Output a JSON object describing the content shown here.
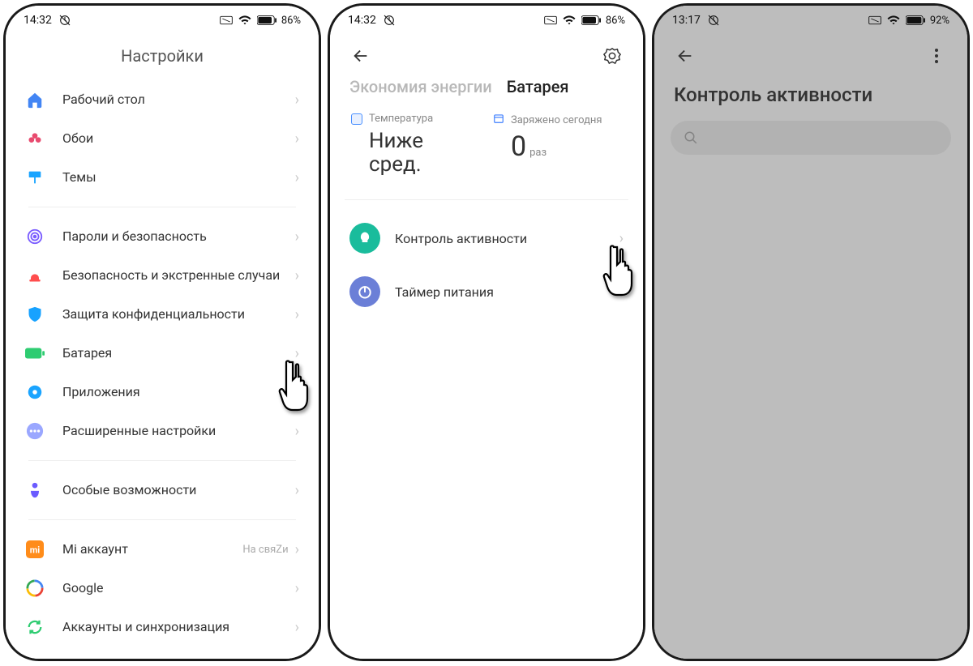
{
  "phones": [
    {
      "status": {
        "time": "14:32",
        "battery_pct": "86%"
      },
      "title": "Настройки",
      "groups": [
        [
          {
            "key": "desktop",
            "label": "Рабочий стол",
            "icon": "home",
            "color": "#4285f4"
          },
          {
            "key": "wallpaper",
            "label": "Обои",
            "icon": "flower",
            "color": "#e84b6f"
          },
          {
            "key": "themes",
            "label": "Темы",
            "icon": "brush",
            "color": "#1aa4ff"
          }
        ],
        [
          {
            "key": "passwords",
            "label": "Пароли и безопасность",
            "icon": "fingerprint",
            "color": "#7a5cff"
          },
          {
            "key": "emergency",
            "label": "Безопасность и экстренные случаи",
            "icon": "alert",
            "color": "#ff4d4d"
          },
          {
            "key": "privacy",
            "label": "Защита конфиденциальности",
            "icon": "shield",
            "color": "#17a2ff"
          },
          {
            "key": "battery",
            "label": "Батарея",
            "icon": "battery",
            "color": "#2ecc71"
          },
          {
            "key": "apps",
            "label": "Приложения",
            "icon": "gear",
            "color": "#1aa4ff"
          },
          {
            "key": "advanced",
            "label": "Расширенные настройки",
            "icon": "dots",
            "color": "#9aa7ff"
          }
        ],
        [
          {
            "key": "accessibility",
            "label": "Особые возможности",
            "icon": "access",
            "color": "#6b5bff"
          }
        ],
        [
          {
            "key": "mi",
            "label": "Mi аккаунт",
            "icon": "mi",
            "color": "#ff8c1a",
            "sub": "На свяZи"
          },
          {
            "key": "google",
            "label": "Google",
            "icon": "google",
            "color": ""
          },
          {
            "key": "accounts",
            "label": "Аккаунты и синхронизация",
            "icon": "sync",
            "color": "#2ecc71"
          }
        ]
      ]
    },
    {
      "status": {
        "time": "14:32",
        "battery_pct": "86%"
      },
      "tabs": {
        "inactive": "Экономия энергии",
        "active": "Батарея"
      },
      "cards": [
        {
          "key": "temp",
          "head": "Температура",
          "value": "Ниже сред."
        },
        {
          "key": "charged_today",
          "head": "Заряжено сегодня",
          "value": "0",
          "unit": "раз"
        }
      ],
      "features": [
        {
          "key": "activity",
          "label": "Контроль активности",
          "color": "cyan",
          "icon": "bulb"
        },
        {
          "key": "timer",
          "label": "Таймер питания",
          "color": "blue",
          "icon": "power"
        }
      ]
    },
    {
      "status": {
        "time": "13:17",
        "battery_pct": "92%"
      },
      "title": "Контроль активности"
    }
  ]
}
